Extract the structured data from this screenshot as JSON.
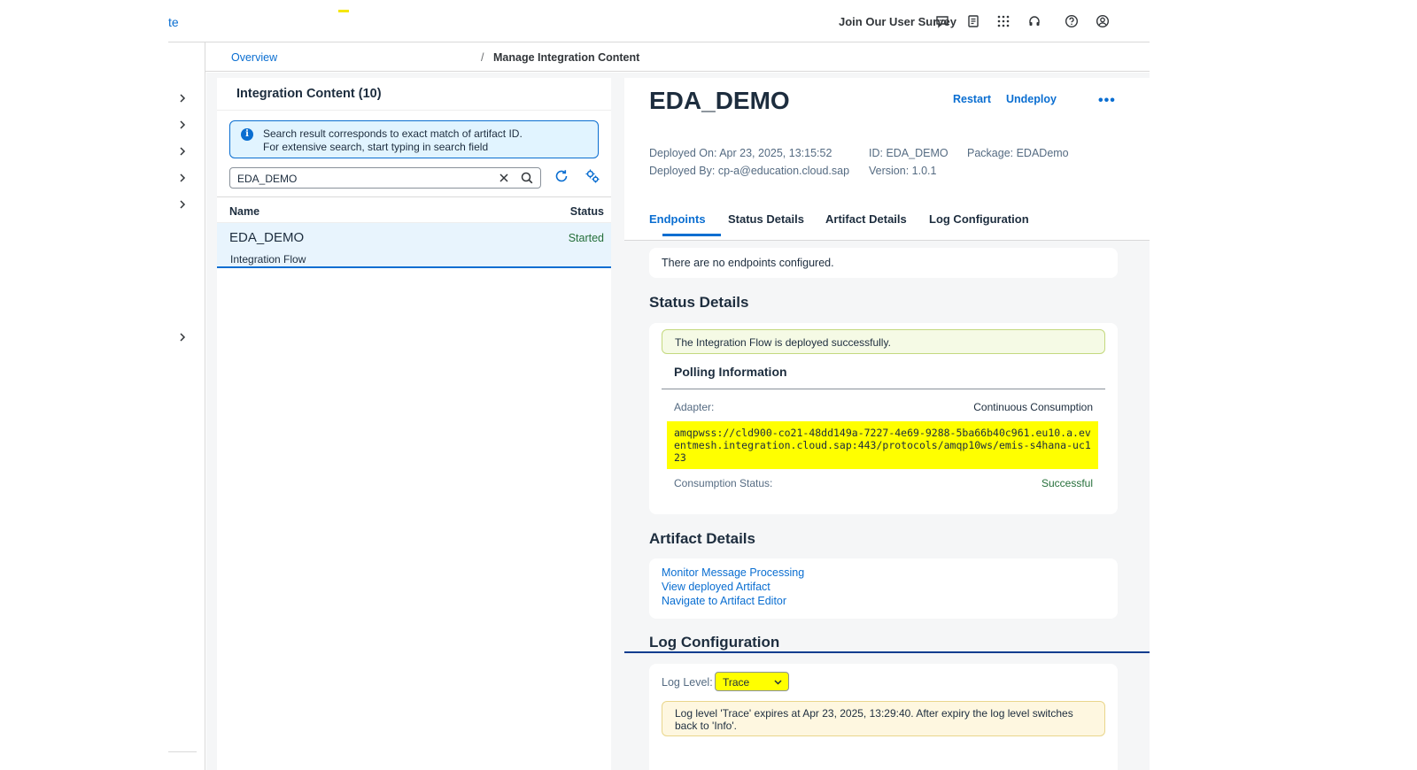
{
  "shell": {
    "title_fragment": "te",
    "survey_link": "Join Our User Survey",
    "icons": [
      "feedback-icon",
      "notes-icon",
      "apps-grid-icon",
      "headset-icon",
      "help-icon",
      "user-icon"
    ]
  },
  "breadcrumb": {
    "overview": "Overview",
    "separator": "/",
    "current": "Manage Integration Content"
  },
  "left_panel": {
    "title": "Integration Content (10)",
    "info": {
      "line1": "Search result corresponds to exact match of artifact ID.",
      "line2": "For extensive search, start typing in search field"
    },
    "search": {
      "value": "EDA_DEMO"
    },
    "table": {
      "headers": {
        "name": "Name",
        "status": "Status"
      },
      "rows": [
        {
          "name": "EDA_DEMO",
          "type": "Integration Flow",
          "status": "Started"
        }
      ]
    }
  },
  "detail": {
    "title": "EDA_DEMO",
    "actions": {
      "restart": "Restart",
      "undeploy": "Undeploy",
      "more": "•••"
    },
    "meta": {
      "deployed_on": "Deployed On: Apr 23, 2025, 13:15:52",
      "deployed_by": "Deployed By: cp-a@education.cloud.sap",
      "id": "ID: EDA_DEMO",
      "version": "Version: 1.0.1",
      "package": "Package: EDADemo"
    },
    "tabs": [
      "Endpoints",
      "Status Details",
      "Artifact Details",
      "Log Configuration"
    ],
    "active_tab": "Endpoints",
    "endpoints": {
      "message": "There are no endpoints configured."
    },
    "status_details": {
      "title": "Status Details",
      "deploy_message": "The Integration Flow is deployed successfully.",
      "polling_title": "Polling Information",
      "adapter_label": "Adapter:",
      "adapter_value": "Continuous Consumption",
      "url": "amqpwss://cld900-co21-48dd149a-7227-4e69-9288-5ba66b40c961.eu10.a.eventmesh.integration.cloud.sap:443/protocols/amqp10ws/emis-s4hana-uc123",
      "consumption_label": "Consumption Status:",
      "consumption_value": "Successful"
    },
    "artifact_details": {
      "title": "Artifact Details",
      "links": [
        "Monitor Message Processing",
        "View deployed Artifact",
        "Navigate to Artifact Editor"
      ]
    },
    "log_configuration": {
      "title": "Log Configuration",
      "level_label": "Log Level:",
      "level_value": "Trace",
      "warning": "Log level 'Trace' expires at Apr 23, 2025, 13:29:40. After expiry the log level switches back to 'Info'."
    }
  },
  "colors": {
    "accent": "#0a6ed1",
    "success": "#256f3a",
    "highlight": "#ffff00"
  }
}
